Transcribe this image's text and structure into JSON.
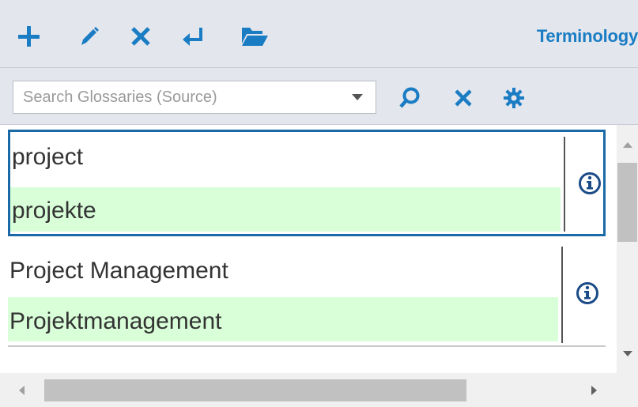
{
  "toolbar": {
    "icons": [
      "plus-icon",
      "pencil-icon",
      "close-icon",
      "return-icon",
      "folder-open-icon"
    ],
    "title": "Terminology",
    "accent_color": "#1a7dc4"
  },
  "search": {
    "placeholder": "Search Glossaries (Source)",
    "value": "",
    "icons": [
      "search-icon",
      "clear-icon",
      "settings-icon"
    ]
  },
  "results": {
    "items": [
      {
        "source": "project",
        "target": "projekte",
        "selected": true
      },
      {
        "source": "Project Management",
        "target": "Projektmanagement",
        "selected": false
      }
    ],
    "target_highlight_color": "#d9ffd9",
    "selection_color": "#1a6aa8"
  }
}
